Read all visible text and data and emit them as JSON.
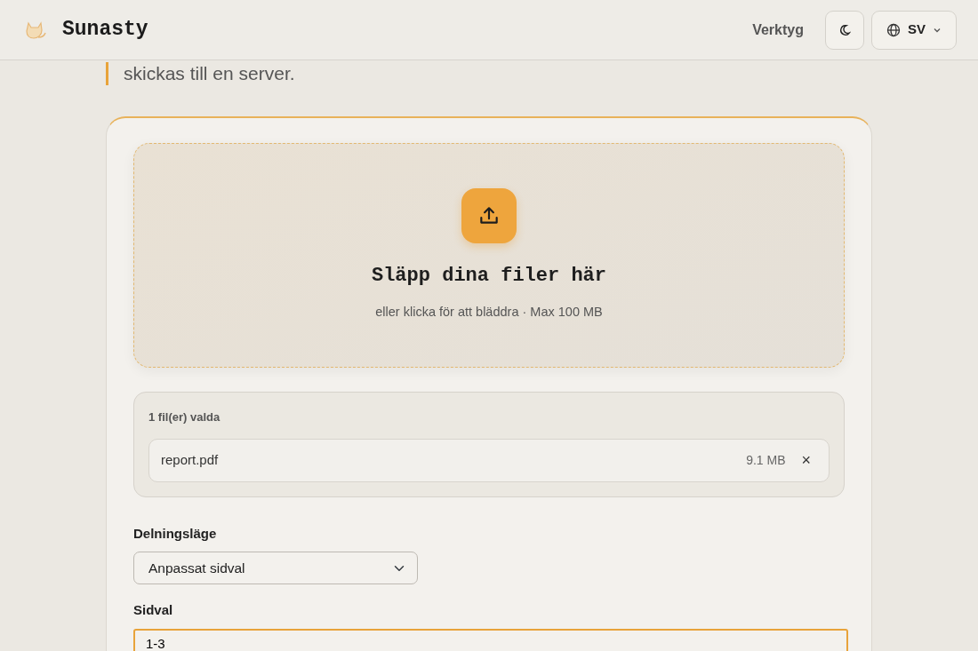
{
  "header": {
    "brand": "Sunasty",
    "nav_link": "Verktyg",
    "language": "SV"
  },
  "intro": {
    "text": "skickas till en server."
  },
  "dropzone": {
    "title": "Släpp dina filer här",
    "subtitle": "eller klicka för att bläddra · Max 100 MB"
  },
  "file_list": {
    "heading": "1 fil(er) valda",
    "files": [
      {
        "name": "report.pdf",
        "size": "9.1 MB",
        "remove": "×"
      }
    ]
  },
  "form": {
    "fields": [
      {
        "kind": "select",
        "label": "Delningsläge",
        "value": "Anpassat sidval",
        "focused": false
      },
      {
        "kind": "text",
        "label": "Sidval",
        "value": "1-3",
        "focused": true
      }
    ]
  }
}
